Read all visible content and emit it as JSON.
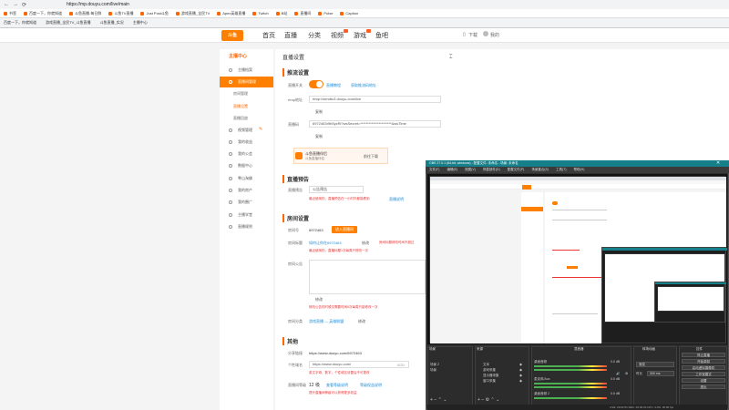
{
  "browser": {
    "url": "https://mp.douyu.com/live/main",
    "bookmarks": [
      "书签",
      "百度一下，你就知道",
      "斗鱼直播-每日鲜",
      "斗鱼TV直播",
      "Just Post斗鱼",
      "游戏直播_全民TV",
      "Apex英雄直播",
      "Twitch",
      "B站",
      "直播间",
      "Pulse",
      "Caption"
    ],
    "tabs": [
      "百度一下，你就知道",
      "游戏直播_全民TV_斗鱼直播",
      "斗鱼直播_实况",
      "主播中心"
    ]
  },
  "site": {
    "logo": "斗鱼",
    "nav": [
      "首页",
      "直播",
      "分类",
      "视频",
      "游戏",
      "鱼吧"
    ],
    "header_right": [
      "下载",
      "我的"
    ]
  },
  "sidebar": {
    "title": "主播中心",
    "items": [
      {
        "label": "主播档案"
      },
      {
        "label": "直播间管理"
      },
      {
        "label": "视频管理"
      },
      {
        "label": "我的收益"
      },
      {
        "label": "我的公会"
      },
      {
        "label": "数据中心"
      },
      {
        "label": "粤山淘佛"
      },
      {
        "label": "我的房产"
      },
      {
        "label": "我的圈广"
      },
      {
        "label": "主播学堂"
      },
      {
        "label": "直播规则"
      }
    ],
    "subs": [
      "房间管理",
      "直播设置",
      "直播回放"
    ]
  },
  "main": {
    "page_title": "直播设置",
    "push": {
      "heading": "推流设置",
      "status_label": "直播开关",
      "status_links": [
        "直播教程",
        "获取推流码地址"
      ],
      "rtmp_label": "rtmp地址",
      "rtmp_value": "rtmp://sendtc3.douyu.com/live",
      "copy1": "复制",
      "code_label": "直播码",
      "code_value": "6972463r9b5yzRi?wsSecret=**********************&wsTime",
      "copy2": "复制",
      "tool_title": "斗鱼直播伴侣",
      "tool_sub": "斗鱼直播伴侣",
      "tool_btn": "前往下载"
    },
    "preview": {
      "heading": "直播预告",
      "label": "直播预告",
      "value": "公告预告",
      "warn": "最近使用的，直播预告在一小时内都能看到",
      "link": "直播说明"
    },
    "room": {
      "heading": "房间设置",
      "id_label": "房间号",
      "id_value": "6972463",
      "id_btn": "进入直播间",
      "notice_label": "房间标题",
      "notice_value": "如何让你在6972463",
      "notice_btn": "修改",
      "notice_warn": "房间标题修改时间不超过",
      "notice_warn2": "最近使用的，直播标题1次每周只修改一次",
      "desc_label": "房间公告",
      "desc_btn": "修改",
      "desc_warn": "修改公告的时候仅需要时间6次每周只能修改一次",
      "cat_label": "房间分类",
      "cat_value": "游戏直播 — 英雄联盟",
      "cat_btn": "修改"
    },
    "other": {
      "heading": "其他",
      "link_label": "分享链接",
      "link_value": "https://www.douyu.com/6972463",
      "domain_label": "个性域名",
      "domain_value": "https://www.douyu.com/",
      "domain_counter": "0/20",
      "domain_warn": "英文字母、数字，个性域名设置后不可更改",
      "level_label": "直播间等级",
      "level_value": "12 级",
      "level_links": [
        "查看等级说明",
        "等级权益说明"
      ],
      "level_warn": "提升直播间等级可以获得更多权益"
    }
  },
  "obs": {
    "title": "OBS 27.0.1 (64-bit, windows) - 配置文件: 未命名 - 场景: 未命名",
    "menu": [
      "文件(F)",
      "编辑(E)",
      "视图(V)",
      "停靠部件(D)",
      "配置文件(P)",
      "场景集合(S)",
      "工具(T)",
      "帮助(H)"
    ],
    "docks": {
      "scenes": {
        "title": "场景",
        "items": [
          "场景 2",
          "场景"
        ]
      },
      "sources": {
        "title": "来源",
        "items": [
          "文本",
          "游戏采集",
          "显示器采集",
          "窗口采集"
        ]
      },
      "mixer": {
        "title": "混音器",
        "channels": [
          {
            "name": "桌面音频",
            "db": "0.0 dB"
          },
          {
            "name": "麦克风/Aux",
            "db": "0.0 dB"
          },
          {
            "name": "桌面音频 2",
            "db": "0.0 dB"
          }
        ]
      },
      "transitions": {
        "title": "转场动画",
        "type": "渐变",
        "duration_label": "时长",
        "duration": "300 ms"
      },
      "controls": {
        "title": "控件",
        "buttons": [
          "停止直播",
          "开始录制",
          "启动虚拟摄像机",
          "工作室模式",
          "设置",
          "退出"
        ]
      }
    },
    "status": "LIVE: 00:02:51  REC: 00:00:00  CPU: 3.0%, 30.00 fps"
  },
  "colors": {
    "brand": "#ff7f00",
    "obs_title": "#16808a",
    "warn": "#e33333",
    "link": "#1a8cd8"
  }
}
